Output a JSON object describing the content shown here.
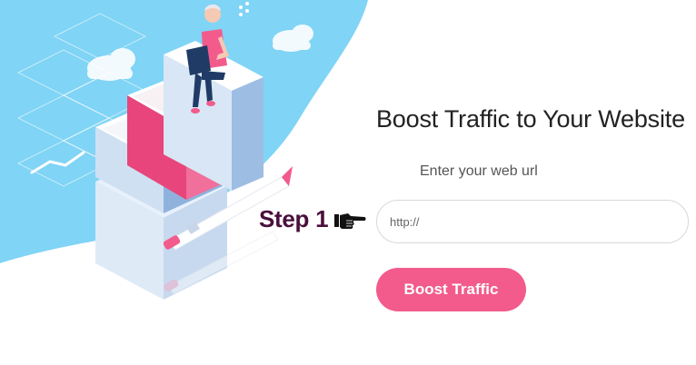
{
  "hero": {
    "headline": "Boost Traffic to Your Website",
    "url_label": "Enter your web url",
    "url_placeholder": "http://",
    "url_value": "",
    "submit_label": "Boost Traffic"
  },
  "annotation": {
    "step_label": "Step 1",
    "pointer_icon": "hand-pointing-right-icon"
  },
  "colors": {
    "accent": "#f25b8c",
    "sky_blue": "#7fd3f5",
    "step_text": "#4a0f3c",
    "headline_text": "#222222"
  }
}
